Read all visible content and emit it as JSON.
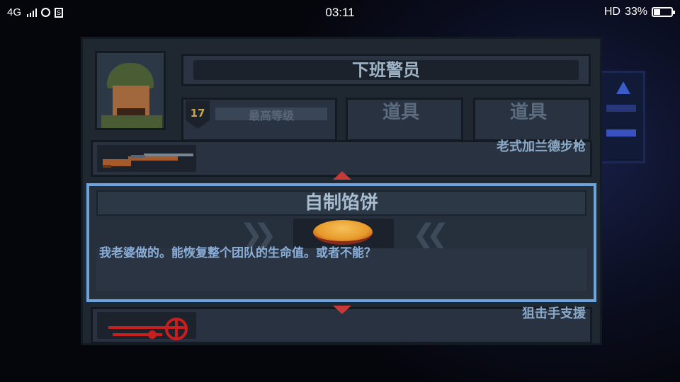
{
  "status_bar": {
    "network": "4G",
    "time": "03:11",
    "hd": "HD",
    "battery": "33%"
  },
  "character": {
    "name": "下班警员",
    "level": "17",
    "level_label": "最高等级"
  },
  "slots": {
    "slot1_title": "道具",
    "slot2_title": "道具"
  },
  "items": {
    "weapon": {
      "name": "老式加兰德步枪",
      "icon": "rifle-icon"
    },
    "support": {
      "name": "狙击手支援",
      "icon": "sniper-scope-icon"
    }
  },
  "selected_item": {
    "name": "自制馅饼",
    "icon": "pie-icon",
    "description": "我老婆做的。能恢复整个团队的生命值。或者不能？"
  },
  "colors": {
    "accent_border": "#6ea4d8",
    "arrow": "#c83a3a",
    "panel": "#1f2731"
  }
}
